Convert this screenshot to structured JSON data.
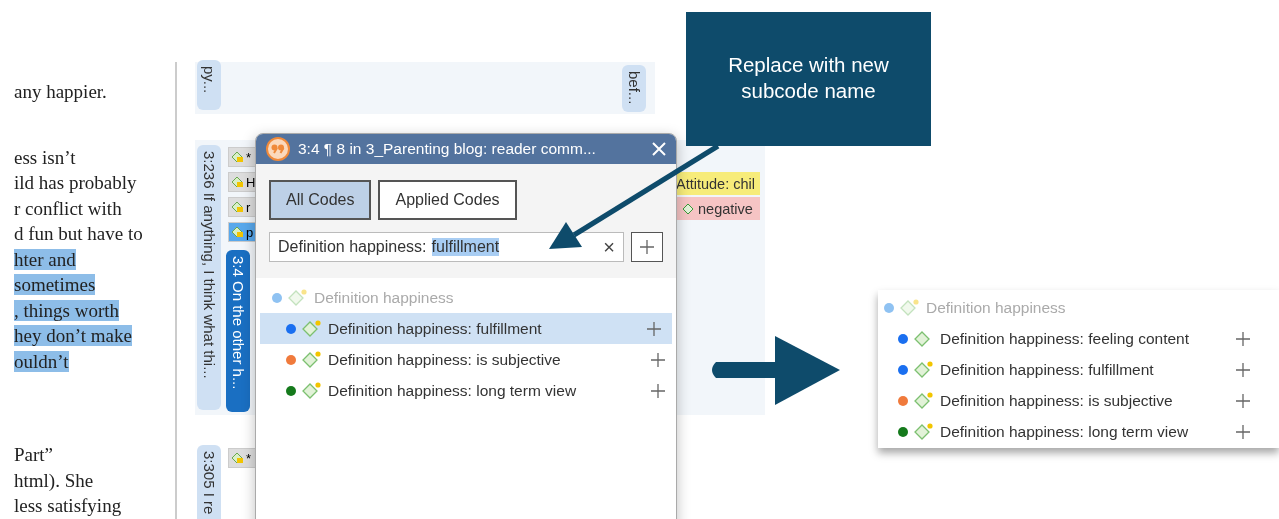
{
  "document": {
    "paragraphs": [
      {
        "lines": [
          {
            "text": "any happier.",
            "highlighted": false
          }
        ]
      },
      {
        "lines": [
          {
            "text": "ess isn’t",
            "highlighted": false
          },
          {
            "text": "ild has probably",
            "highlighted": false
          },
          {
            "text": "r conflict with",
            "highlighted": false
          },
          {
            "text": "d fun but have to",
            "highlighted": false
          },
          {
            "text": "hter and",
            "highlighted": true
          },
          {
            "text": "sometimes",
            "highlighted": true
          },
          {
            "text": ", things worth",
            "highlighted": true
          },
          {
            "text": "hey don’t make",
            "highlighted": true
          },
          {
            "text": "ouldn’t",
            "highlighted": true
          }
        ]
      },
      {
        "lines": [
          {
            "text": "Part”",
            "highlighted": false
          },
          {
            "text": "html). She",
            "highlighted": false
          },
          {
            "text": "less satisfying",
            "highlighted": false
          }
        ]
      }
    ]
  },
  "margin": {
    "quotes": [
      {
        "label": "py...",
        "selected": false
      },
      {
        "label": "bef...",
        "selected": false
      },
      {
        "label": "3:236 If anything, I think what thi...",
        "selected": false
      },
      {
        "label": "3:4 On the other h...",
        "selected": true
      },
      {
        "label": "3:305 I re",
        "selected": false
      }
    ],
    "code_chips": [
      {
        "label": "*",
        "selected": false
      },
      {
        "label": "H",
        "selected": false
      },
      {
        "label": "r",
        "selected": false
      },
      {
        "label": "p",
        "selected": true
      },
      {
        "label": "*",
        "selected": false
      }
    ],
    "side_codes": [
      {
        "label": "Attitude: chil",
        "color": "#f7ec7a",
        "kind": "plain"
      },
      {
        "label": "negative",
        "color": "#f6c4c4",
        "kind": "code"
      }
    ]
  },
  "popup": {
    "title": "3:4 ¶ 8 in 3_Parenting blog: reader comm...",
    "tabs": [
      {
        "label": "All Codes",
        "selected": true
      },
      {
        "label": "Applied Codes",
        "selected": false
      }
    ],
    "search": {
      "value": "Definition happiness:",
      "selected_text": "fulfillment",
      "clear": "×"
    },
    "tree": {
      "label": "Definition happiness",
      "color": "#8fc2f2",
      "flagged": true,
      "children": [
        {
          "label": "Definition happiness: fulfillment",
          "color": "#1a6ff0",
          "flagged": true,
          "selected": true
        },
        {
          "label": "Definition happiness: is subjective",
          "color": "#f07a3c",
          "flagged": true,
          "selected": false
        },
        {
          "label": "Definition happiness: long term view",
          "color": "#157a1c",
          "flagged": true,
          "selected": false
        }
      ]
    }
  },
  "callout": {
    "text": "Replace with new subcode name"
  },
  "result": {
    "tree": {
      "label": "Definition happiness",
      "color": "#8fc2f2",
      "flagged": true,
      "children": [
        {
          "label": "Definition happiness: feeling content",
          "color": "#1a6ff0",
          "flagged": false
        },
        {
          "label": "Definition happiness: fulfillment",
          "color": "#1a6ff0",
          "flagged": true
        },
        {
          "label": "Definition happiness: is subjective",
          "color": "#f07a3c",
          "flagged": true
        },
        {
          "label": "Definition happiness: long term view",
          "color": "#157a1c",
          "flagged": true
        }
      ]
    }
  }
}
